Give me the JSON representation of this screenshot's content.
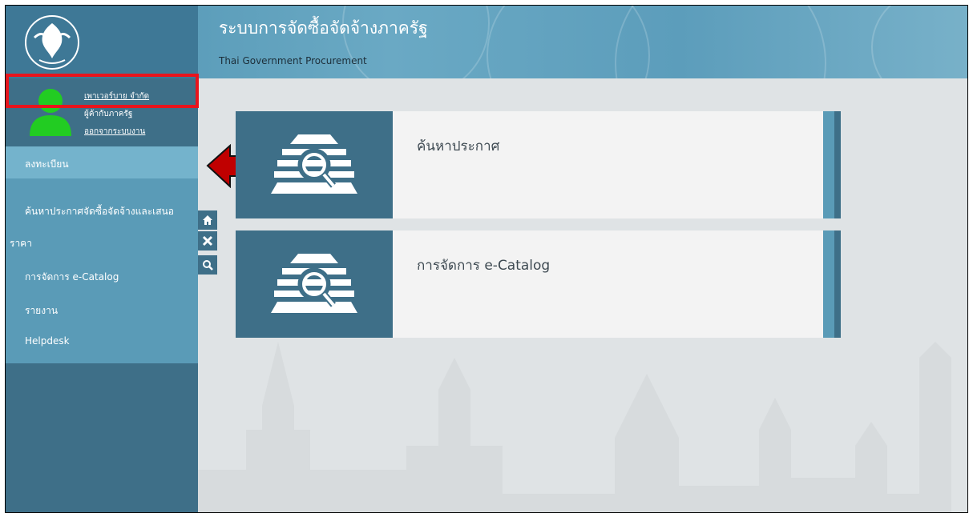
{
  "header": {
    "title": "ระบบการจัดซื้อจัดจ้างภาครัฐ",
    "subtitle": "Thai Government Procurement"
  },
  "user": {
    "company": "เพาเวอร์บาย จำกัด",
    "role": "ผู้ค้ากับภาครัฐ",
    "logout": "ออกจากระบบงาน"
  },
  "sidebar": {
    "items": [
      {
        "label": "ลงทะเบียน"
      },
      {
        "label": "ค้นหาประกาศจัดซื้อจัดจ้างและเสนอ"
      },
      {
        "label": "ราคา"
      },
      {
        "label": "การจัดการ e-Catalog"
      },
      {
        "label": "รายงาน"
      },
      {
        "label": "Helpdesk"
      }
    ]
  },
  "tools": [
    "home-icon",
    "close-icon",
    "search-icon"
  ],
  "cards": [
    {
      "label": "ค้นหาประกาศ",
      "icon": "search-document-icon"
    },
    {
      "label": "การจัดการ e-Catalog",
      "icon": "search-document-icon"
    }
  ],
  "colors": {
    "highlight": "#e8141c",
    "arrow": "#c00000",
    "avatar": "#22cc22",
    "sidebar": "#3e6f88",
    "menu": "#5a9bb7"
  }
}
